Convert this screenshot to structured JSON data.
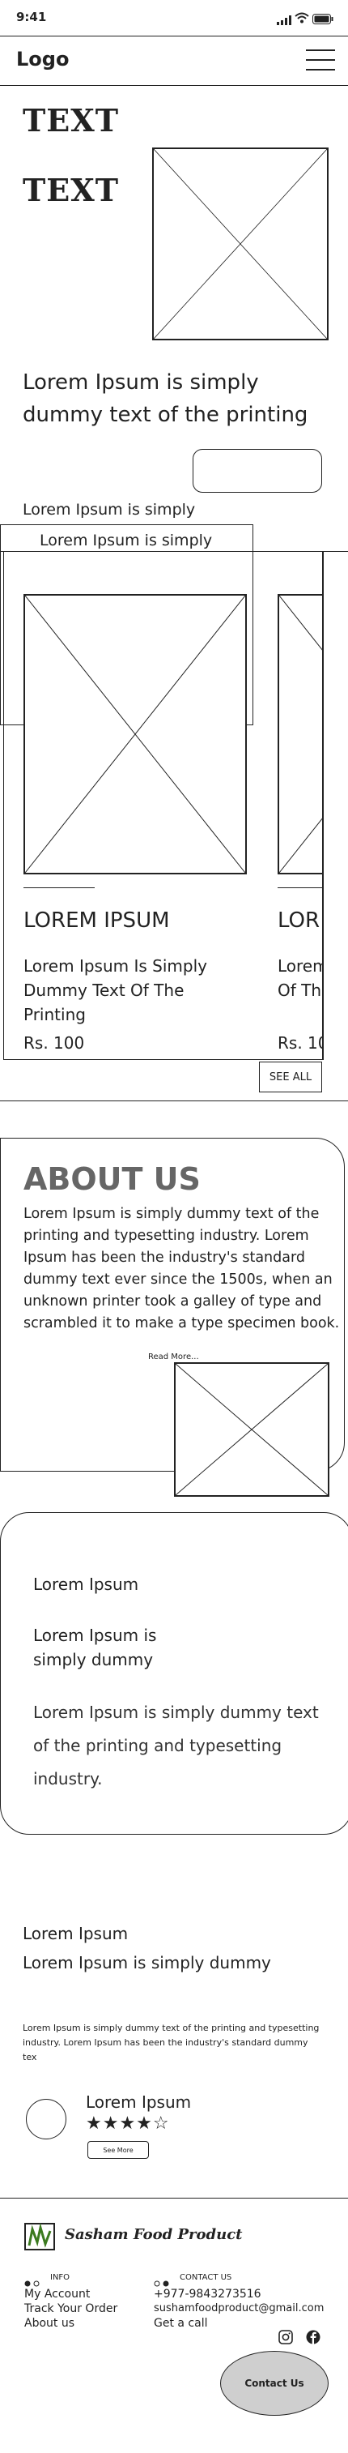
{
  "status_bar": {
    "time": "9:41"
  },
  "header": {
    "logo": "Logo"
  },
  "hero": {
    "title_1": "TEXT",
    "title_2": "TEXT",
    "tagline": "Lorem Ipsum is simply dummy text of the printing"
  },
  "featured": {
    "heading": "Lorem Ipsum is simply",
    "tab_label": "Lorem Ipsum is simply"
  },
  "products": [
    {
      "name": "LOREM IPSUM",
      "description": "Lorem Ipsum Is Simply Dummy Text Of The Printing",
      "price": "Rs. 100"
    },
    {
      "name": "LOR",
      "description": "Lorem Of Th",
      "price": "Rs. 10"
    }
  ],
  "see_all": "SEE ALL",
  "about": {
    "heading": "ABOUT US",
    "body": "Lorem Ipsum is simply dummy text of the printing and typesetting industry. Lorem Ipsum has been the industry's standard dummy text ever since the 1500s, when an unknown printer took a galley of type and scrambled it to make a type specimen book.",
    "read_more": "Read More..."
  },
  "info_card": {
    "line_1": "Lorem Ipsum",
    "line_2": "Lorem Ipsum is simply dummy",
    "body": "Lorem Ipsum is simply dummy text of the printing and typesetting industry."
  },
  "testimonial": {
    "heading_1": "Lorem Ipsum",
    "heading_2": "Lorem Ipsum is simply dummy",
    "body": "Lorem Ipsum is simply dummy text of the printing and typesetting industry. Lorem Ipsum has been the industry's standard dummy tex",
    "name": "Lorem Ipsum",
    "rating": 4,
    "rating_max": 5,
    "stars": "★★★★☆",
    "see_more": "See More"
  },
  "footer": {
    "brand": "Sasham Food Product",
    "info_heading": "INFO",
    "info_links": [
      "My Account",
      "Track Your Order",
      "About us"
    ],
    "contact_heading": "CONTACT US",
    "phone": "+977-9843273516",
    "email": "sushamfoodproduct@gmail.com",
    "call": "Get a call",
    "contact_button": "Contact Us"
  }
}
